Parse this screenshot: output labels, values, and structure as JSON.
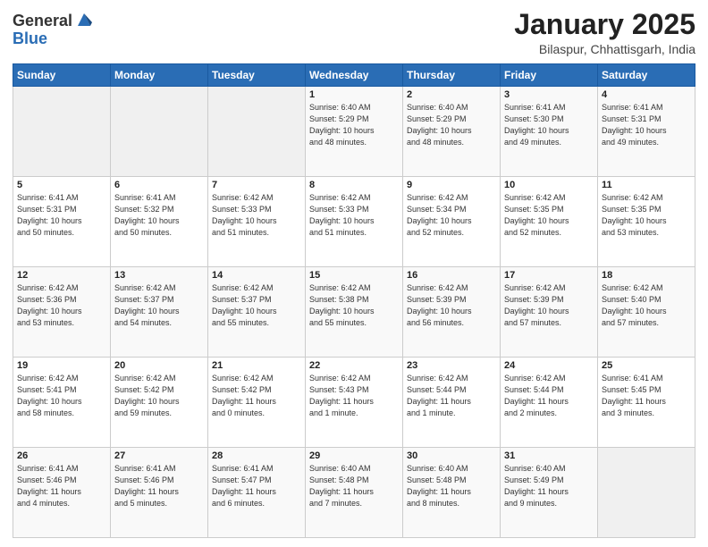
{
  "logo": {
    "general": "General",
    "blue": "Blue"
  },
  "header": {
    "month": "January 2025",
    "location": "Bilaspur, Chhattisgarh, India"
  },
  "weekdays": [
    "Sunday",
    "Monday",
    "Tuesday",
    "Wednesday",
    "Thursday",
    "Friday",
    "Saturday"
  ],
  "weeks": [
    [
      {
        "day": "",
        "info": ""
      },
      {
        "day": "",
        "info": ""
      },
      {
        "day": "",
        "info": ""
      },
      {
        "day": "1",
        "info": "Sunrise: 6:40 AM\nSunset: 5:29 PM\nDaylight: 10 hours\nand 48 minutes."
      },
      {
        "day": "2",
        "info": "Sunrise: 6:40 AM\nSunset: 5:29 PM\nDaylight: 10 hours\nand 48 minutes."
      },
      {
        "day": "3",
        "info": "Sunrise: 6:41 AM\nSunset: 5:30 PM\nDaylight: 10 hours\nand 49 minutes."
      },
      {
        "day": "4",
        "info": "Sunrise: 6:41 AM\nSunset: 5:31 PM\nDaylight: 10 hours\nand 49 minutes."
      }
    ],
    [
      {
        "day": "5",
        "info": "Sunrise: 6:41 AM\nSunset: 5:31 PM\nDaylight: 10 hours\nand 50 minutes."
      },
      {
        "day": "6",
        "info": "Sunrise: 6:41 AM\nSunset: 5:32 PM\nDaylight: 10 hours\nand 50 minutes."
      },
      {
        "day": "7",
        "info": "Sunrise: 6:42 AM\nSunset: 5:33 PM\nDaylight: 10 hours\nand 51 minutes."
      },
      {
        "day": "8",
        "info": "Sunrise: 6:42 AM\nSunset: 5:33 PM\nDaylight: 10 hours\nand 51 minutes."
      },
      {
        "day": "9",
        "info": "Sunrise: 6:42 AM\nSunset: 5:34 PM\nDaylight: 10 hours\nand 52 minutes."
      },
      {
        "day": "10",
        "info": "Sunrise: 6:42 AM\nSunset: 5:35 PM\nDaylight: 10 hours\nand 52 minutes."
      },
      {
        "day": "11",
        "info": "Sunrise: 6:42 AM\nSunset: 5:35 PM\nDaylight: 10 hours\nand 53 minutes."
      }
    ],
    [
      {
        "day": "12",
        "info": "Sunrise: 6:42 AM\nSunset: 5:36 PM\nDaylight: 10 hours\nand 53 minutes."
      },
      {
        "day": "13",
        "info": "Sunrise: 6:42 AM\nSunset: 5:37 PM\nDaylight: 10 hours\nand 54 minutes."
      },
      {
        "day": "14",
        "info": "Sunrise: 6:42 AM\nSunset: 5:37 PM\nDaylight: 10 hours\nand 55 minutes."
      },
      {
        "day": "15",
        "info": "Sunrise: 6:42 AM\nSunset: 5:38 PM\nDaylight: 10 hours\nand 55 minutes."
      },
      {
        "day": "16",
        "info": "Sunrise: 6:42 AM\nSunset: 5:39 PM\nDaylight: 10 hours\nand 56 minutes."
      },
      {
        "day": "17",
        "info": "Sunrise: 6:42 AM\nSunset: 5:39 PM\nDaylight: 10 hours\nand 57 minutes."
      },
      {
        "day": "18",
        "info": "Sunrise: 6:42 AM\nSunset: 5:40 PM\nDaylight: 10 hours\nand 57 minutes."
      }
    ],
    [
      {
        "day": "19",
        "info": "Sunrise: 6:42 AM\nSunset: 5:41 PM\nDaylight: 10 hours\nand 58 minutes."
      },
      {
        "day": "20",
        "info": "Sunrise: 6:42 AM\nSunset: 5:42 PM\nDaylight: 10 hours\nand 59 minutes."
      },
      {
        "day": "21",
        "info": "Sunrise: 6:42 AM\nSunset: 5:42 PM\nDaylight: 11 hours\nand 0 minutes."
      },
      {
        "day": "22",
        "info": "Sunrise: 6:42 AM\nSunset: 5:43 PM\nDaylight: 11 hours\nand 1 minute."
      },
      {
        "day": "23",
        "info": "Sunrise: 6:42 AM\nSunset: 5:44 PM\nDaylight: 11 hours\nand 1 minute."
      },
      {
        "day": "24",
        "info": "Sunrise: 6:42 AM\nSunset: 5:44 PM\nDaylight: 11 hours\nand 2 minutes."
      },
      {
        "day": "25",
        "info": "Sunrise: 6:41 AM\nSunset: 5:45 PM\nDaylight: 11 hours\nand 3 minutes."
      }
    ],
    [
      {
        "day": "26",
        "info": "Sunrise: 6:41 AM\nSunset: 5:46 PM\nDaylight: 11 hours\nand 4 minutes."
      },
      {
        "day": "27",
        "info": "Sunrise: 6:41 AM\nSunset: 5:46 PM\nDaylight: 11 hours\nand 5 minutes."
      },
      {
        "day": "28",
        "info": "Sunrise: 6:41 AM\nSunset: 5:47 PM\nDaylight: 11 hours\nand 6 minutes."
      },
      {
        "day": "29",
        "info": "Sunrise: 6:40 AM\nSunset: 5:48 PM\nDaylight: 11 hours\nand 7 minutes."
      },
      {
        "day": "30",
        "info": "Sunrise: 6:40 AM\nSunset: 5:48 PM\nDaylight: 11 hours\nand 8 minutes."
      },
      {
        "day": "31",
        "info": "Sunrise: 6:40 AM\nSunset: 5:49 PM\nDaylight: 11 hours\nand 9 minutes."
      },
      {
        "day": "",
        "info": ""
      }
    ]
  ]
}
